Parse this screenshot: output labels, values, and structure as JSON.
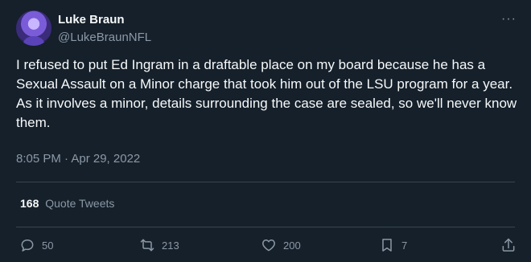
{
  "author": {
    "display_name": "Luke Braun",
    "handle": "@LukeBraunNFL"
  },
  "tweet": {
    "text": "I refused to put Ed Ingram in a draftable place on my board because he has a Sexual Assault on a Minor charge that took him out of the LSU program for a year. As it involves a minor, details surrounding the case are sealed, so we'll never know them.",
    "timestamp": "8:05 PM · Apr 29, 2022"
  },
  "stats": {
    "quote_count": "168",
    "quote_label": "Quote Tweets"
  },
  "actions": {
    "replies": "50",
    "retweets": "213",
    "likes": "200",
    "bookmarks": "7"
  },
  "icons": {
    "more": "more-icon",
    "reply": "reply-icon",
    "retweet": "retweet-icon",
    "like": "heart-icon",
    "bookmark": "bookmark-icon",
    "share": "share-icon"
  },
  "colors": {
    "background": "#15202b",
    "text_primary": "#f7f9f9",
    "text_secondary": "#8b98a5",
    "divider": "#38444d"
  }
}
